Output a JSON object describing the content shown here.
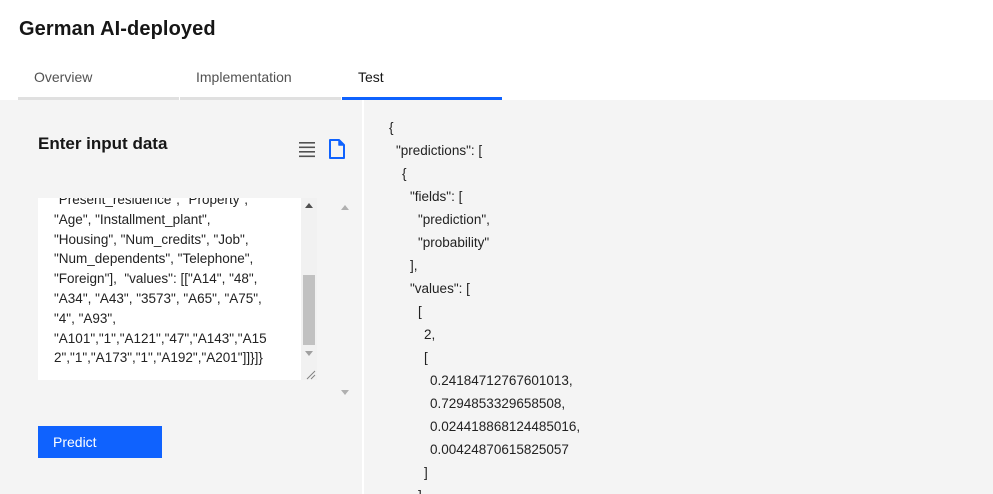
{
  "header": {
    "title": "German AI-deployed"
  },
  "tabs": [
    {
      "label": "Overview"
    },
    {
      "label": "Implementation"
    },
    {
      "label": "Test"
    }
  ],
  "input_panel": {
    "heading": "Enter input data",
    "icons": {
      "list": "list-icon",
      "file": "file-icon"
    },
    "textarea_value": "\"Present_residence\", \"Property\",\n\"Age\", \"Installment_plant\",\n\"Housing\", \"Num_credits\", \"Job\",\n\"Num_dependents\", \"Telephone\",\n\"Foreign\"],  \"values\": [[\"A14\", \"48\",\n\"A34\", \"A43\", \"3573\", \"A65\", \"A75\",\n\"4\", \"A93\",\n\"A101\",\"1\",\"A121\",\"47\",\"A143\",\"A15\n2\",\"1\",\"A173\",\"1\",\"A192\",\"A201\"]]}]}",
    "predict_label": "Predict"
  },
  "output": {
    "lines": [
      "{",
      "\"predictions\": [",
      "{",
      "\"fields\": [",
      "\"prediction\",",
      "\"probability\"",
      "],",
      "\"values\": [",
      "[",
      "2,",
      "[",
      "0.24184712767601013,",
      "0.7294853329658508,",
      "0.024418868124485016,",
      "0.00424870615825057",
      "]",
      "]"
    ]
  },
  "colors": {
    "accent": "#0f62fe",
    "panel_bg": "#f4f4f4",
    "tab_inactive_border": "#e0e0e0"
  }
}
